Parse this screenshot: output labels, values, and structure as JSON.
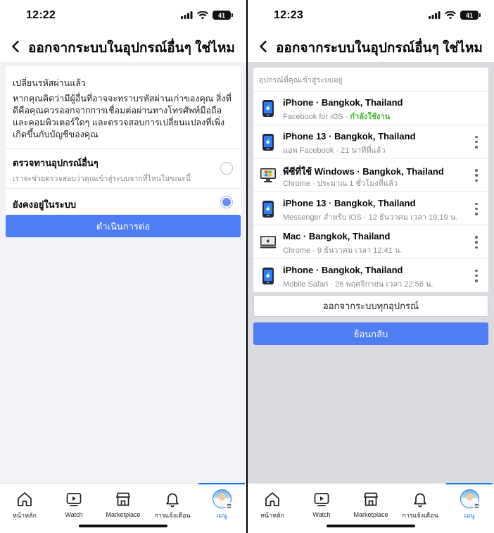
{
  "left": {
    "status_time": "12:22",
    "battery": "41",
    "title": "ออกจากระบบในอุปกรณ์อื่นๆ ใช่ไหม",
    "info_title": "เปลี่ยนรหัสผ่านแล้ว",
    "info_body": "หากคุณคิดว่ามีผู้อื่นที่อาจจะทราบรหัสผ่านเก่าของคุณ สิ่งที่ดีคือคุณควรออกจากการเชื่อมต่อผ่านทางโทรศัพท์มือถือและคอมพิวเตอร์ใดๆ และตรวจสอบการเปลี่ยนแปลงที่เพิ่งเกิดขึ้นกับบัญชีของคุณ",
    "options": [
      {
        "label": "ตรวจทานอุปกรณ์อื่นๆ",
        "sub": "เราจะช่วยตรวจสอบว่าคุณเข้าสู่ระบบจากที่ไหนในขณะนี้",
        "selected": false
      },
      {
        "label": "ยังคงอยู่ในระบบ",
        "sub": "",
        "selected": true
      }
    ],
    "continue_label": "ดำเนินการต่อ"
  },
  "right": {
    "status_time": "12:23",
    "battery": "41",
    "title": "ออกจากระบบในอุปกรณ์อื่นๆ ใช่ไหม",
    "devices_header": "อุปกรณ์ที่คุณเข้าสู่ระบบอยู่",
    "devices": [
      {
        "icon": "iphone-icon",
        "name": "iPhone · Bangkok, Thailand",
        "meta": "Facebook for iOS · ",
        "active": "กำลังใช้งาน",
        "menu": false
      },
      {
        "icon": "iphone-icon",
        "name": "iPhone 13 · Bangkok, Thailand",
        "meta": "แอพ Facebook · 21 นาทีที่แล้ว",
        "active": "",
        "menu": true
      },
      {
        "icon": "windows-pc-icon",
        "name": "พีซีที่ใช้ Windows · Bangkok, Thailand",
        "meta": "Chrome · ประมาณ 1 ชั่วโมงที่แล้ว",
        "active": "",
        "menu": true
      },
      {
        "icon": "iphone-icon",
        "name": "iPhone 13 · Bangkok, Thailand",
        "meta": "Messenger สำหรับ iOS · 12 ธันวาคม เวลา 19:19 น.",
        "active": "",
        "menu": true
      },
      {
        "icon": "mac-icon",
        "name": "Mac · Bangkok, Thailand",
        "meta": "Chrome · 9 ธันวาคม เวลา 12:41 น.",
        "active": "",
        "menu": true
      },
      {
        "icon": "iphone-icon",
        "name": "iPhone · Bangkok, Thailand",
        "meta": "Mobile Safari · 26 พฤศจิกายน เวลา 22:56 น.",
        "active": "",
        "menu": true
      }
    ],
    "logout_all_label": "ออกจากระบบทุกอุปกรณ์",
    "back_label": "ย้อนกลับ"
  },
  "tabs": [
    {
      "icon": "home-icon",
      "label": "หน้าหลัก"
    },
    {
      "icon": "watch-icon",
      "label": "Watch"
    },
    {
      "icon": "marketplace-icon",
      "label": "Marketplace"
    },
    {
      "icon": "bell-icon",
      "label": "การแจ้งเตือน"
    },
    {
      "icon": "avatar",
      "label": "เมนู",
      "active": true
    }
  ],
  "colors": {
    "primary_button": "#4f7df3",
    "active_green": "#42b72a",
    "tab_active": "#1877f2",
    "page_gray": "#f0f2f5"
  }
}
